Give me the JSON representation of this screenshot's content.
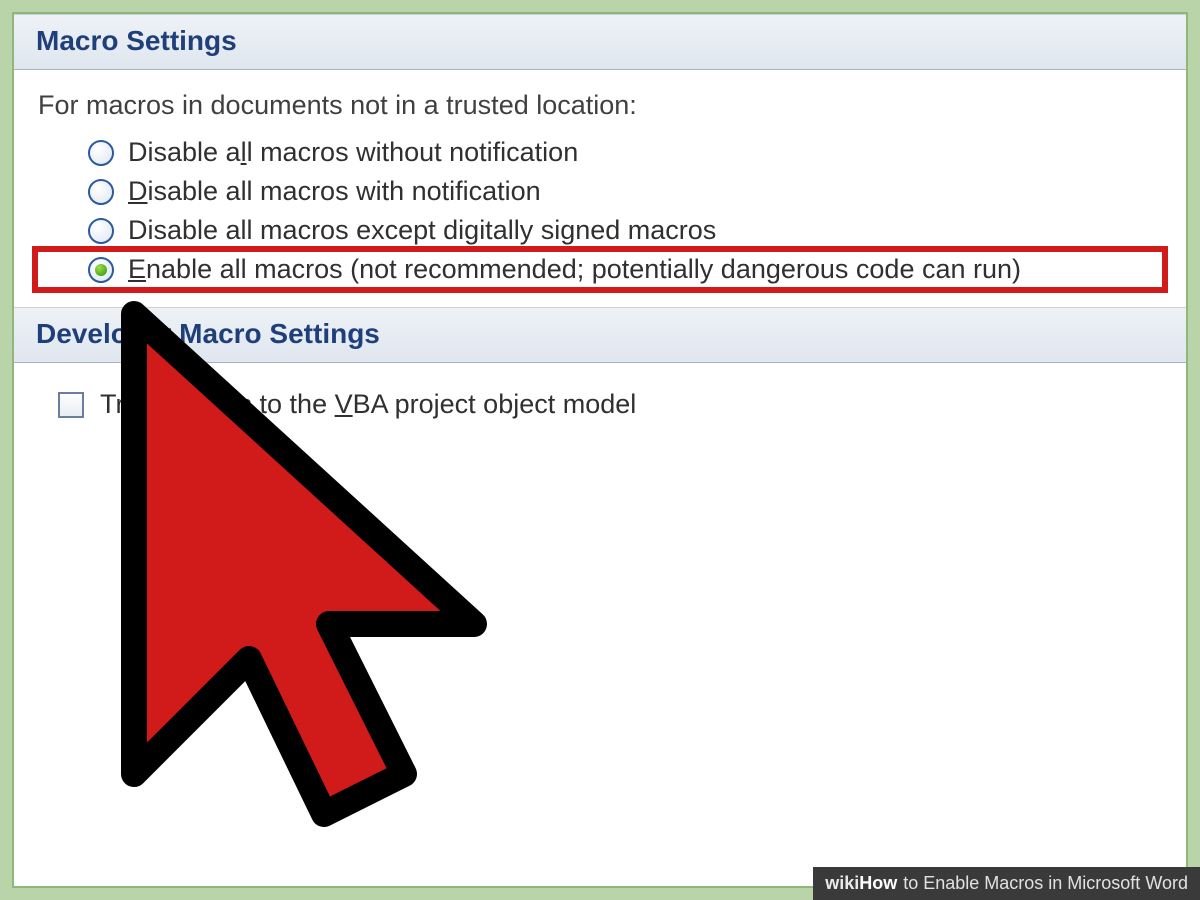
{
  "sections": {
    "macro": {
      "title": "Macro Settings",
      "intro": "For macros in documents not in a trusted location:",
      "options": [
        {
          "prefix": "Disable a",
          "u": "l",
          "suffix": "l macros without notification",
          "selected": false,
          "highlight": false
        },
        {
          "prefix": "",
          "u": "D",
          "suffix": "isable all macros with notification",
          "selected": false,
          "highlight": false
        },
        {
          "prefix": "Disable all macros except di",
          "u": "g",
          "suffix": "itally signed macros",
          "selected": false,
          "highlight": false
        },
        {
          "prefix": "",
          "u": "E",
          "suffix": "nable all macros (not recommended; potentially dangerous code can run)",
          "selected": true,
          "highlight": true
        }
      ]
    },
    "developer": {
      "title": "Developer Macro Settings",
      "checkbox": {
        "prefix": "Trust access to the ",
        "u": "V",
        "suffix": "BA project object model",
        "checked": false
      }
    }
  },
  "caption": {
    "brand1": "wiki",
    "brand2": "How",
    "text": "to Enable Macros in Microsoft Word"
  }
}
